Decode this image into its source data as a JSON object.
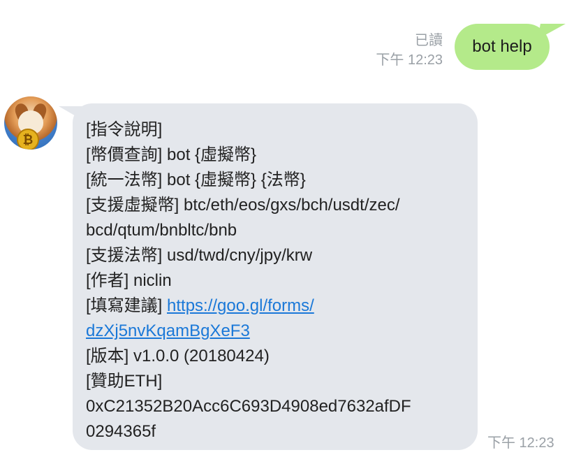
{
  "outgoing": {
    "read_status": "已讀",
    "time": "下午 12:23",
    "text": "bot help",
    "bubble_color": "#b4ea8a"
  },
  "incoming": {
    "avatar_icon": "corgi-bitcoin-avatar",
    "coin_symbol": "₿",
    "bubble_color": "#e4e7ec",
    "link_color": "#1a78d8",
    "lines": [
      "[指令說明]",
      "[幣價查詢] bot {虛擬幣}",
      "[統一法幣] bot {虛擬幣} {法幣}",
      "[支援虛擬幣] btc/eth/eos/gxs/bch/usdt/zec/",
      "bcd/qtum/bnbltc/bnb",
      "[支援法幣] usd/twd/cny/jpy/krw",
      "[作者] niclin"
    ],
    "feedback_label": "[填寫建議] ",
    "feedback_link_part1": "https://goo.gl/forms/",
    "feedback_link_part2": "dzXj5nvKqamBgXeF3",
    "version_line": "[版本] v1.0.0 (20180424)",
    "sponsor_label": "[贊助ETH]",
    "eth_address_part1": "0xC21352B20Acc6C693D4908ed7632afDF",
    "eth_address_part2": "0294365f",
    "time": "下午 12:23"
  }
}
